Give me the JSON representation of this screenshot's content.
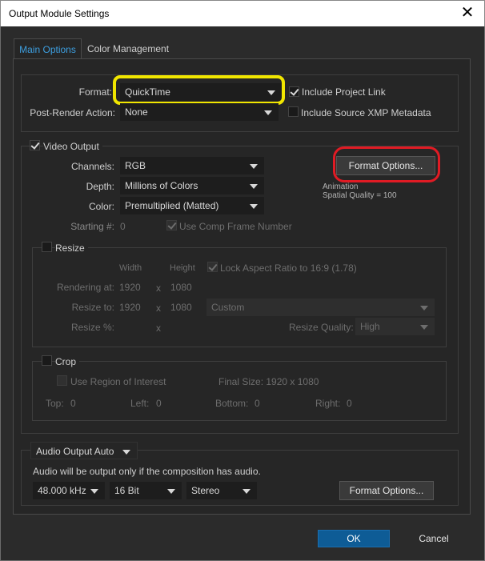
{
  "window": {
    "title": "Output Module Settings"
  },
  "tabs": [
    {
      "label": "Main Options"
    },
    {
      "label": "Color Management"
    }
  ],
  "format": {
    "label": "Format:",
    "value": "QuickTime",
    "include_project_link": "Include Project Link",
    "post_render_label": "Post-Render Action:",
    "post_render_value": "None",
    "include_xmp": "Include Source XMP Metadata"
  },
  "video": {
    "label": "Video Output",
    "channels_label": "Channels:",
    "channels_value": "RGB",
    "depth_label": "Depth:",
    "depth_value": "Millions of Colors",
    "color_label": "Color:",
    "color_value": "Premultiplied (Matted)",
    "starting_label": "Starting #:",
    "starting_value": "0",
    "use_comp_frame": "Use Comp Frame Number",
    "format_options_button": "Format Options...",
    "codec_line1": "Animation",
    "codec_line2": "Spatial Quality = 100"
  },
  "resize": {
    "label": "Resize",
    "width_header": "Width",
    "height_header": "Height",
    "lock_aspect": "Lock Aspect Ratio to 16:9 (1.78)",
    "rendering_label": "Rendering at:",
    "rendering_w": "1920",
    "rendering_h": "1080",
    "resize_to_label": "Resize to:",
    "resize_to_w": "1920",
    "resize_to_h": "1080",
    "x_sep": "x",
    "preset": "Custom",
    "resize_pct_label": "Resize %:",
    "quality_label": "Resize Quality:",
    "quality_value": "High"
  },
  "crop": {
    "label": "Crop",
    "use_roi": "Use Region of Interest",
    "final_size": "Final Size: 1920 x 1080",
    "top_label": "Top:",
    "top_value": "0",
    "left_label": "Left:",
    "left_value": "0",
    "bottom_label": "Bottom:",
    "bottom_value": "0",
    "right_label": "Right:",
    "right_value": "0"
  },
  "audio": {
    "mode": "Audio Output Auto",
    "note": "Audio will be output only if the composition has audio.",
    "rate": "48.000 kHz",
    "bits": "16 Bit",
    "channels": "Stereo",
    "format_options_button": "Format Options..."
  },
  "footer": {
    "ok": "OK",
    "cancel": "Cancel"
  },
  "highlight_colors": {
    "yellow": "#f1e600",
    "red": "#e01b24",
    "accent": "#3d9fe0"
  }
}
